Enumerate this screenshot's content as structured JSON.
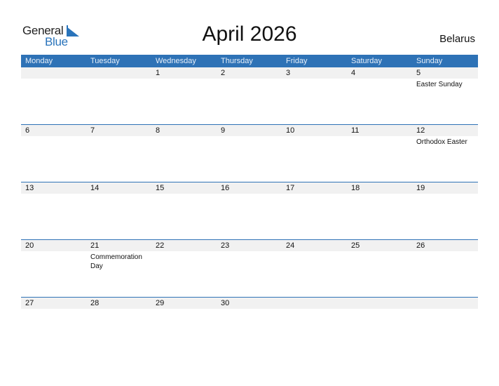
{
  "logo": {
    "text_top": "General",
    "text_bottom": "Blue"
  },
  "header": {
    "title": "April 2026",
    "country": "Belarus"
  },
  "colors": {
    "accent": "#2e72b6",
    "strip": "#f1f1f1",
    "logo_blue": "#2a74bb"
  },
  "weekdays": [
    "Monday",
    "Tuesday",
    "Wednesday",
    "Thursday",
    "Friday",
    "Saturday",
    "Sunday"
  ],
  "weeks": [
    [
      {
        "day": ""
      },
      {
        "day": ""
      },
      {
        "day": "1"
      },
      {
        "day": "2"
      },
      {
        "day": "3"
      },
      {
        "day": "4"
      },
      {
        "day": "5",
        "event": "Easter Sunday"
      }
    ],
    [
      {
        "day": "6"
      },
      {
        "day": "7"
      },
      {
        "day": "8"
      },
      {
        "day": "9"
      },
      {
        "day": "10"
      },
      {
        "day": "11"
      },
      {
        "day": "12",
        "event": "Orthodox Easter"
      }
    ],
    [
      {
        "day": "13"
      },
      {
        "day": "14"
      },
      {
        "day": "15"
      },
      {
        "day": "16"
      },
      {
        "day": "17"
      },
      {
        "day": "18"
      },
      {
        "day": "19"
      }
    ],
    [
      {
        "day": "20"
      },
      {
        "day": "21",
        "event": "Commemoration Day"
      },
      {
        "day": "22"
      },
      {
        "day": "23"
      },
      {
        "day": "24"
      },
      {
        "day": "25"
      },
      {
        "day": "26"
      }
    ],
    [
      {
        "day": "27"
      },
      {
        "day": "28"
      },
      {
        "day": "29"
      },
      {
        "day": "30"
      },
      {
        "day": ""
      },
      {
        "day": ""
      },
      {
        "day": ""
      }
    ]
  ]
}
